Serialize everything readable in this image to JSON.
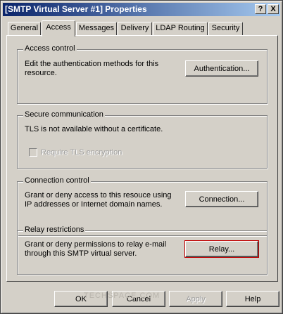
{
  "window": {
    "title": "[SMTP Virtual Server #1] Properties",
    "help_button": "?",
    "close_button": "X"
  },
  "tabs": [
    {
      "label": "General"
    },
    {
      "label": "Access",
      "active": true
    },
    {
      "label": "Messages"
    },
    {
      "label": "Delivery"
    },
    {
      "label": "LDAP Routing"
    },
    {
      "label": "Security"
    }
  ],
  "access_control": {
    "label": "Access control",
    "line1": "Edit the authentication methods for this",
    "line2": "resource.",
    "button": "Authentication..."
  },
  "secure_communication": {
    "label": "Secure communication",
    "text": "TLS is not available without a certificate.",
    "checkbox_label": "Require TLS encryption",
    "checkbox_checked": false,
    "checkbox_enabled": false
  },
  "connection_control": {
    "label": "Connection control",
    "line1": "Grant or deny access to this resouce using",
    "line2": "IP addresses or Internet domain names.",
    "button": "Connection..."
  },
  "relay_restrictions": {
    "label": "Relay restrictions",
    "line1": "Grant or deny permissions to relay e-mail",
    "line2": "through this SMTP virtual server.",
    "button": "Relay..."
  },
  "footer": {
    "ok": "OK",
    "cancel": "Cancel",
    "apply": "Apply",
    "help": "Help"
  },
  "watermark": "TECHSPACE.COM"
}
